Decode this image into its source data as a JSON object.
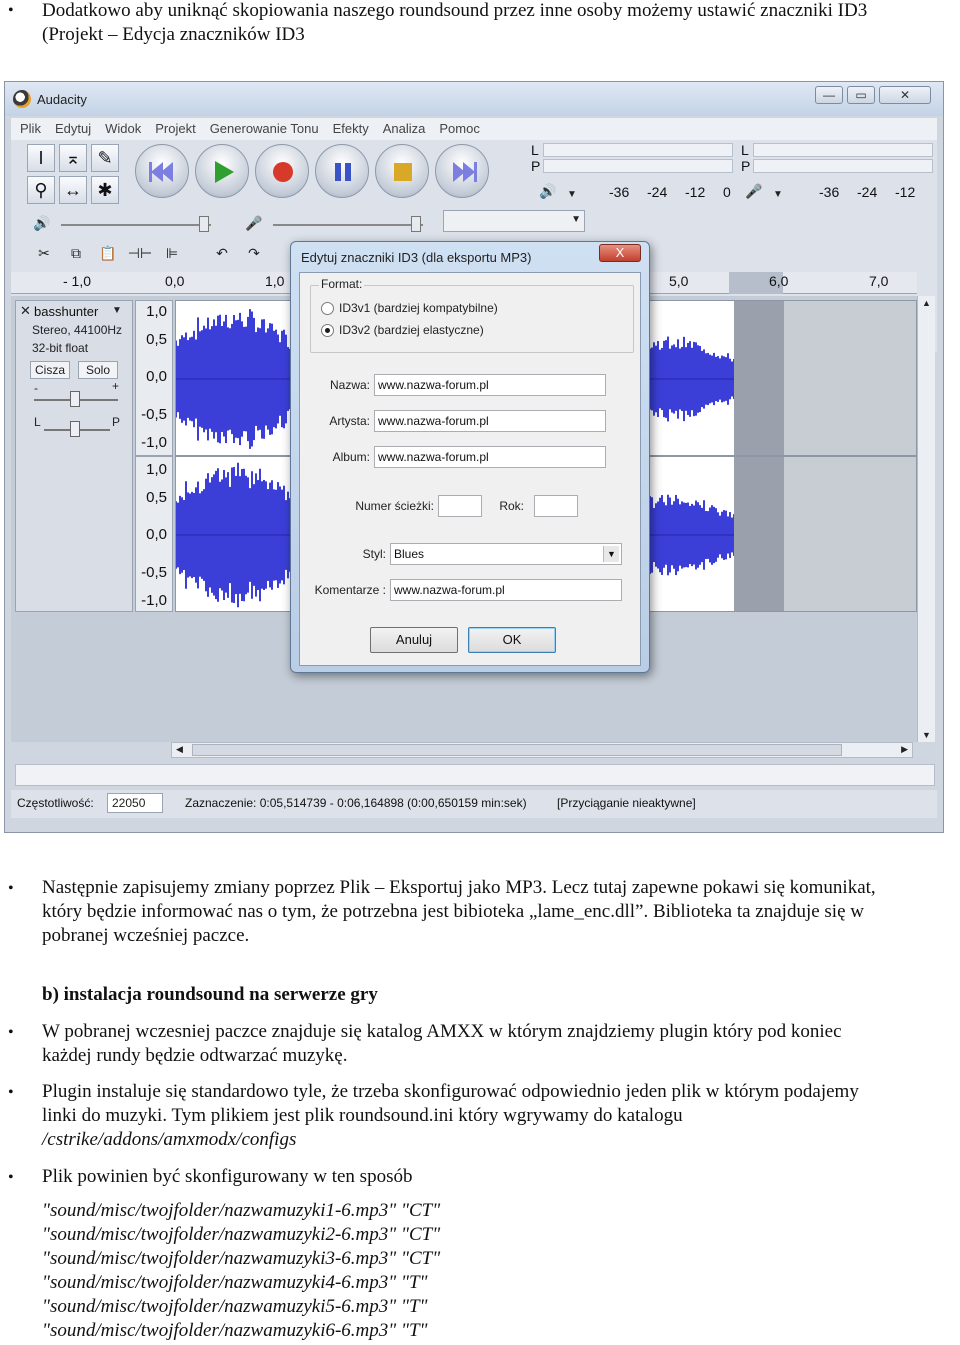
{
  "intro": {
    "line1": "Dodatkowo aby uniknąć skopiowania naszego roundsound przez inne osoby możemy ustawić znaczniki ID3",
    "line2": "(Projekt – Edycja znaczników ID3"
  },
  "audacity": {
    "title": "Audacity",
    "menu": [
      "Plik",
      "Edytuj",
      "Widok",
      "Projekt",
      "Generowanie Tonu",
      "Efekty",
      "Analiza",
      "Pomoc"
    ],
    "meters": {
      "lp": [
        "L",
        "P"
      ],
      "ticks": [
        "-36",
        "-24",
        "-12",
        "0"
      ]
    },
    "ruler": [
      "- 1,0",
      "0,0",
      "1,0",
      "5,0",
      "6,0",
      "7,0"
    ],
    "track": {
      "name": "basshunter",
      "info1": "Stereo, 44100Hz",
      "info2": "32-bit float",
      "mute": "Cisza",
      "solo": "Solo",
      "gain_minus": "-",
      "gain_plus": "+",
      "pan_l": "L",
      "pan_r": "P"
    },
    "scale": [
      "1,0",
      "0,5",
      "0,0",
      "-0,5",
      "-1,0"
    ],
    "status": {
      "rate_label": "Częstotliwość:",
      "rate_value": "22050",
      "selection": "Zaznaczenie: 0:05,514739 - 0:06,164898 (0:00,650159 min:sek)",
      "snap": "[Przyciąganie nieaktywne]"
    }
  },
  "dialog": {
    "title": "Edytuj znaczniki ID3 (dla eksportu MP3)",
    "close": "X",
    "format_legend": "Format:",
    "radio1": "ID3v1 (bardziej kompatybilne)",
    "radio2": "ID3v2 (bardziej elastyczne)",
    "selected_format": "ID3v2",
    "name_label": "Nazwa:",
    "name_value": "www.nazwa-forum.pl",
    "artist_label": "Artysta:",
    "artist_value": "www.nazwa-forum.pl",
    "album_label": "Album:",
    "album_value": "www.nazwa-forum.pl",
    "track_label": "Numer ścieżki:",
    "track_value": "",
    "year_label": "Rok:",
    "year_value": "",
    "genre_label": "Styl:",
    "genre_value": "Blues",
    "comment_label": "Komentarze :",
    "comment_value": "www.nazwa-forum.pl",
    "cancel": "Anuluj",
    "ok": "OK"
  },
  "body": {
    "p1_l1": "Następnie zapisujemy zmiany poprzez Plik – Eksportuj jako MP3. Lecz tutaj zapewne pokawi się komunikat,",
    "p1_l2": "który będzie informować nas o tym, że potrzebna jest bibioteka „lame_enc.dll”. Biblioteka ta znajduje się w",
    "p1_l3": "pobranej wcześniej paczce.",
    "heading": "b) instalacja roundsound na serwerze gry",
    "p2_l1": "W pobranej wczesniej paczce znajduje się katalog AMXX w którym znajdziemy plugin który pod koniec",
    "p2_l2": "każdej rundy będzie odtwarzać muzykę.",
    "p3_l1": "Plugin instaluje się standardowo tyle, że trzeba skonfigurować odpowiednio jeden plik w którym podajemy",
    "p3_l2": "linki do muzyki. Tym plikiem jest plik roundsound.ini który wgrywamy do katalogu",
    "p3_l3": "/cstrike/addons/amxmodx/configs",
    "p4_l1": "Plik powinien być skonfigurowany w ten sposób",
    "config": [
      "\"sound/misc/twojfolder/nazwamuzyki1-6.mp3\" \"CT\"",
      "\"sound/misc/twojfolder/nazwamuzyki2-6.mp3\" \"CT\"",
      "\"sound/misc/twojfolder/nazwamuzyki3-6.mp3\" \"CT\"",
      "\"sound/misc/twojfolder/nazwamuzyki4-6.mp3\" \"T\"",
      "\"sound/misc/twojfolder/nazwamuzyki5-6.mp3\" \"T\"",
      "\"sound/misc/twojfolder/nazwamuzyki6-6.mp3\" \"T\""
    ]
  }
}
